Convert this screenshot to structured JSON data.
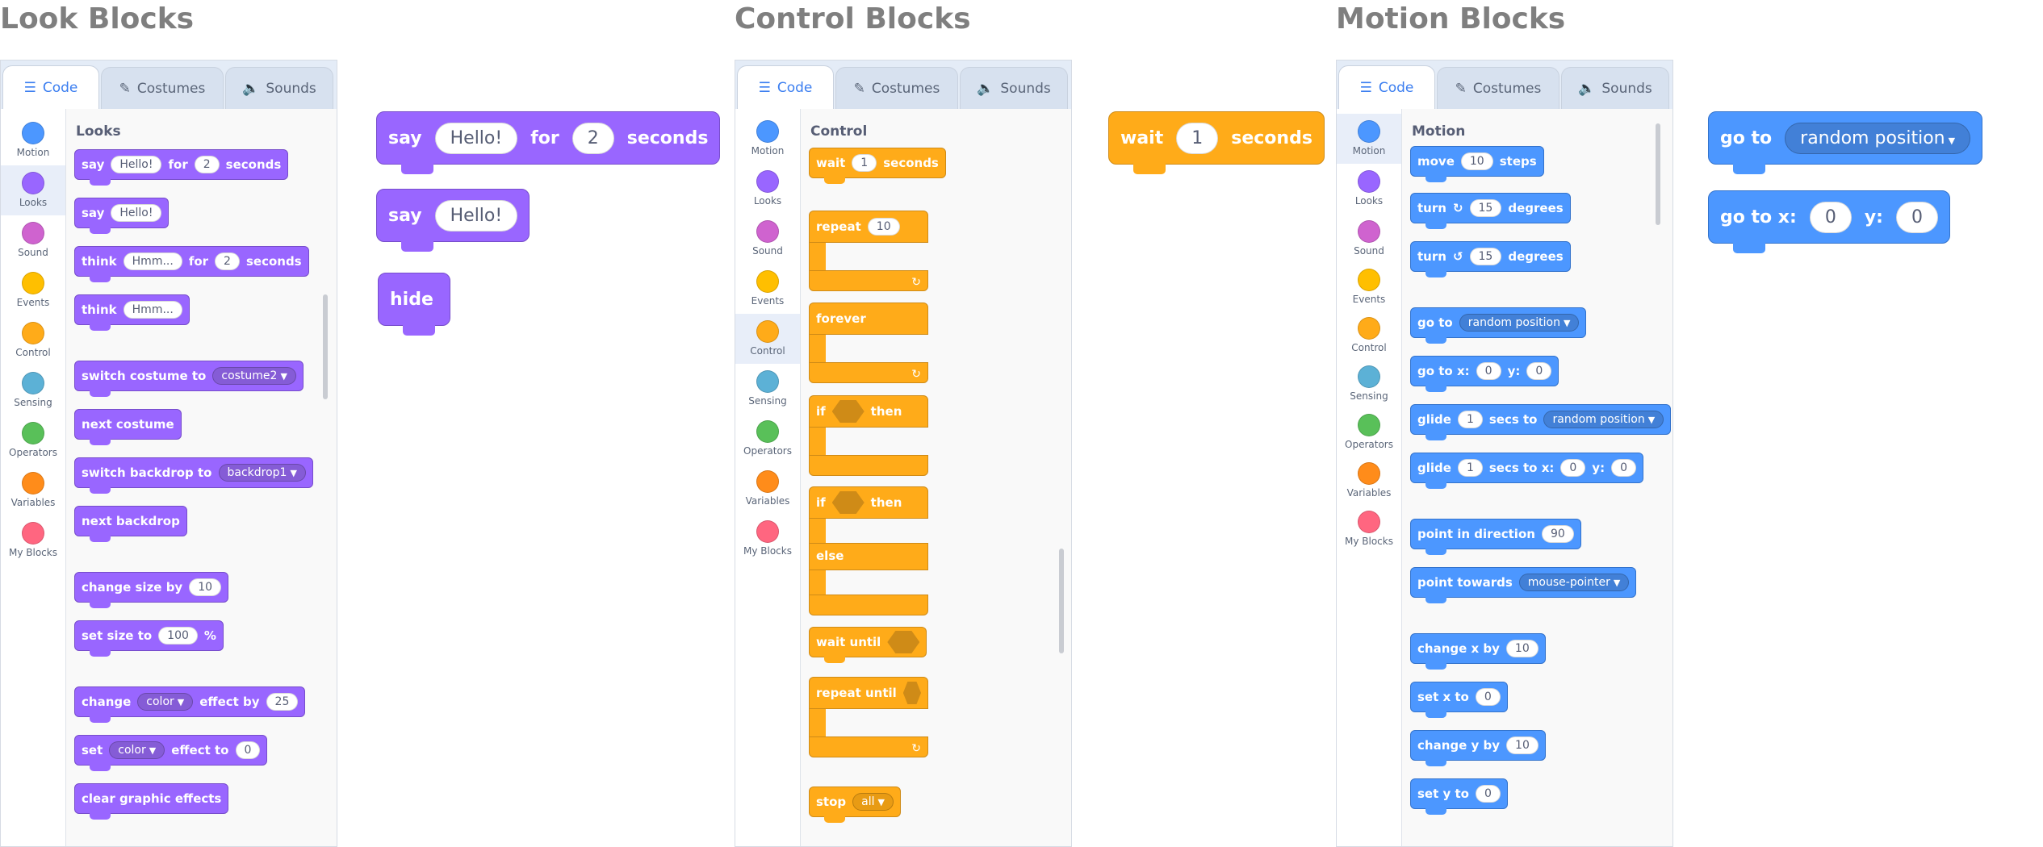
{
  "sections": {
    "looks_title": "Look Blocks",
    "control_title": "Control Blocks",
    "motion_title": "Motion Blocks"
  },
  "tabs": {
    "code": "Code",
    "costumes": "Costumes",
    "sounds": "Sounds"
  },
  "categories": [
    {
      "label": "Motion",
      "color": "#4c97ff"
    },
    {
      "label": "Looks",
      "color": "#9966ff"
    },
    {
      "label": "Sound",
      "color": "#cf63cf"
    },
    {
      "label": "Events",
      "color": "#ffbf00"
    },
    {
      "label": "Control",
      "color": "#ffab19"
    },
    {
      "label": "Sensing",
      "color": "#5cb1d6"
    },
    {
      "label": "Operators",
      "color": "#59c059"
    },
    {
      "label": "Variables",
      "color": "#ff8c1a"
    },
    {
      "label": "My Blocks",
      "color": "#ff6680"
    }
  ],
  "looks": {
    "header": "Looks",
    "say_for": {
      "say": "say",
      "msg": "Hello!",
      "for": "for",
      "secs": "2",
      "seconds": "seconds"
    },
    "say": {
      "say": "say",
      "msg": "Hello!"
    },
    "think_for": {
      "think": "think",
      "msg": "Hmm...",
      "for": "for",
      "secs": "2",
      "seconds": "seconds"
    },
    "think": {
      "think": "think",
      "msg": "Hmm..."
    },
    "switch_costume": {
      "label": "switch costume to",
      "value": "costume2"
    },
    "next_costume": "next costume",
    "switch_backdrop": {
      "label": "switch backdrop to",
      "value": "backdrop1"
    },
    "next_backdrop": "next backdrop",
    "change_size": {
      "label": "change size by",
      "value": "10"
    },
    "set_size": {
      "label": "set size to",
      "value": "100",
      "unit": "%"
    },
    "change_effect": {
      "change": "change",
      "effect": "color",
      "by": "effect by",
      "value": "25"
    },
    "set_effect": {
      "set": "set",
      "effect": "color",
      "to": "effect to",
      "value": "0"
    },
    "clear_effects": "clear graphic effects"
  },
  "looks_workspace": {
    "say_for": {
      "say": "say",
      "msg": "Hello!",
      "for": "for",
      "secs": "2",
      "seconds": "seconds"
    },
    "say": {
      "say": "say",
      "msg": "Hello!"
    },
    "hide": "hide"
  },
  "control": {
    "header": "Control",
    "wait": {
      "wait": "wait",
      "value": "1",
      "seconds": "seconds"
    },
    "repeat": {
      "label": "repeat",
      "value": "10"
    },
    "forever": "forever",
    "if_then": {
      "if": "if",
      "then": "then"
    },
    "if_else": {
      "if": "if",
      "then": "then",
      "else": "else"
    },
    "wait_until": "wait until",
    "repeat_until": "repeat until",
    "stop": {
      "label": "stop",
      "value": "all"
    }
  },
  "control_workspace": {
    "wait": {
      "wait": "wait",
      "value": "1",
      "seconds": "seconds"
    }
  },
  "motion": {
    "header": "Motion",
    "move": {
      "move": "move",
      "value": "10",
      "steps": "steps"
    },
    "turn_right": {
      "turn": "turn",
      "value": "15",
      "degrees": "degrees"
    },
    "turn_left": {
      "turn": "turn",
      "value": "15",
      "degrees": "degrees"
    },
    "goto": {
      "label": "go to",
      "value": "random position"
    },
    "goto_xy": {
      "label": "go to x:",
      "x": "0",
      "ylabel": "y:",
      "y": "0"
    },
    "glide_to": {
      "glide": "glide",
      "secs": "1",
      "secs_to": "secs to",
      "value": "random position"
    },
    "glide_xy": {
      "glide": "glide",
      "secs": "1",
      "secs_to_x": "secs to x:",
      "x": "0",
      "ylabel": "y:",
      "y": "0"
    },
    "point_direction": {
      "label": "point in direction",
      "value": "90"
    },
    "point_towards": {
      "label": "point towards",
      "value": "mouse-pointer"
    },
    "change_x": {
      "label": "change x by",
      "value": "10"
    },
    "set_x": {
      "label": "set x to",
      "value": "0"
    },
    "change_y": {
      "label": "change y by",
      "value": "10"
    },
    "set_y": {
      "label": "set y to",
      "value": "0"
    }
  },
  "motion_workspace": {
    "goto": {
      "label": "go to",
      "value": "random position"
    },
    "goto_xy": {
      "label": "go to x:",
      "x": "0",
      "ylabel": "y:",
      "y": "0"
    }
  },
  "icons": {
    "code_tab": "code-icon",
    "costumes_tab": "brush-icon",
    "sounds_tab": "speaker-icon",
    "loop_arrow": "loop-arrow-icon",
    "turn_right": "rotate-right-icon",
    "turn_left": "rotate-left-icon",
    "dropdown": "chevron-down-icon"
  }
}
